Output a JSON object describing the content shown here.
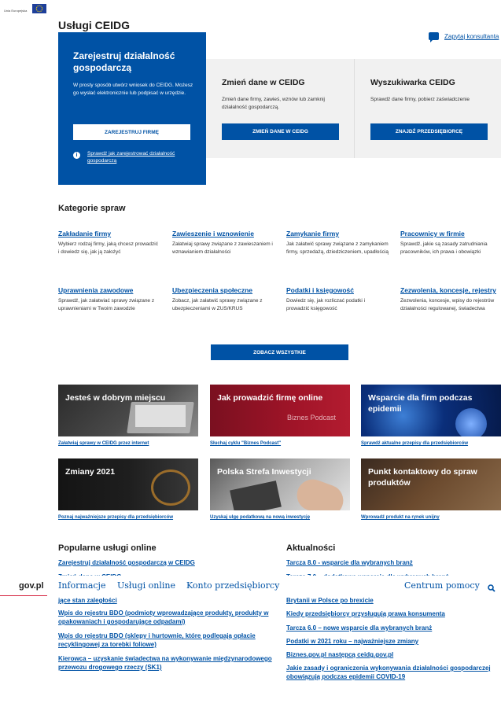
{
  "eu_label": "Unia Europejska",
  "page_title": "Usługi CEIDG",
  "consult_link": "Zapytaj konsultanta",
  "hero": {
    "title": "Zarejestruj działalność gospodarczą",
    "desc": "W prosty sposób utwórz wniosek do CEIDG. Możesz go wysłać elektronicznie lub podpisać w urzędzie.",
    "button": "ZAREJESTRUJ FIRMĘ",
    "info_link": "Sprawdź jak zarejestrować działalność gospodarczą"
  },
  "cards": [
    {
      "title": "Zmień dane w CEIDG",
      "desc": "Zmień dane firmy, zawieś, wznów lub zamknij działalność gospodarczą.",
      "button": "ZMIEŃ DANE W CEIDG"
    },
    {
      "title": "Wyszukiwarka CEIDG",
      "desc": "Sprawdź dane firmy, pobierz zaświadczenie",
      "button": "ZNAJDŹ PRZEDSIĘBIORCĘ"
    }
  ],
  "categories_title": "Kategorie spraw",
  "categories": [
    {
      "title": "Zakładanie firmy",
      "desc": "Wybierz rodzaj firmy, jaką chcesz prowadzić i dowiedz się, jak ją założyć"
    },
    {
      "title": "Zawieszenie i wznowienie",
      "desc": "Załatwiaj sprawy związane z zawieszaniem i wznawianiem działalności"
    },
    {
      "title": "Zamykanie firmy",
      "desc": "Jak załatwić sprawy związane z zamykaniem firmy, sprzedażą, dziedziczeniem, upadłością"
    },
    {
      "title": "Pracownicy w firmie",
      "desc": "Sprawdź, jakie są zasady zatrudniania pracowników, ich prawa i obowiązki"
    },
    {
      "title": "Uprawnienia zawodowe",
      "desc": "Sprawdź, jak załatwiać sprawy związane z uprawnieniami w Twoim zawodzie"
    },
    {
      "title": "Ubezpieczenia społeczne",
      "desc": "Zobacz, jak załatwić sprawy związane z ubezpieczeniami w ZUS/KRUS"
    },
    {
      "title": "Podatki i księgowość",
      "desc": "Dowiedz się, jak rozliczać podatki i prowadzić księgowość"
    },
    {
      "title": "Zezwolenia, koncesje, rejestry",
      "desc": "Zezwolenia, koncesje, wpisy do rejestrów działalności regulowanej, świadectwa"
    }
  ],
  "see_all": "ZOBACZ WSZYSTKIE",
  "tiles": [
    {
      "title": "Jesteś w dobrym miejscu",
      "caption": "Załatwiaj sprawy w CEIDG przez internet",
      "subtitle": ""
    },
    {
      "title": "Jak prowadzić firmę online",
      "caption": "Słuchaj cyklu \"Biznes Podcast\"",
      "subtitle": "Biznes Podcast"
    },
    {
      "title": "Wsparcie dla firm podczas epidemii",
      "caption": "Sprawdź aktualne przepisy dla przedsiębiorców",
      "subtitle": ""
    },
    {
      "title": "Zmiany 2021",
      "caption": "Poznaj najważniejsze przepisy dla przedsiębiorców",
      "subtitle": ""
    },
    {
      "title": "Polska Strefa Inwestycji",
      "caption": "Uzyskaj ulgę podatkową na nową inwestycję",
      "subtitle": ""
    },
    {
      "title": "Punkt kontaktowy do spraw produktów",
      "caption": "Wprowadź produkt na rynek unijny",
      "subtitle": ""
    }
  ],
  "popular_title": "Popularne usługi online",
  "popular": [
    "Zarejestruj działalność gospodarczą w CEIDG",
    "Zmień dane w CEIDG",
    "jące stan zaległości",
    "Wpis do rejestru BDO (podmioty wprowadzające produkty, produkty w opakowaniach i gospodarujące odpadami)",
    "Wpis do rejestru BDO (sklepy i hurtownie, które podlegają opłacie recyklingowej za torebki foliowe)",
    "Kierowca – uzyskanie świadectwa na wykonywanie międzynarodowego przewozu drogowego rzeczy (SK1)"
  ],
  "news_title": "Aktualności",
  "news": [
    "Tarcza 8.0 - wsparcie dla wybranych branż",
    "Tarcza 7.0 – dodatkowe wsparcie dla wybranych branż",
    "Brytanii w Polsce po brexicie",
    "Kiedy przedsiębiorcy przysługują prawa konsumenta",
    "Tarcza 6.0 – nowe wsparcie dla wybranych branż",
    "Podatki w 2021 roku – najważniejsze zmiany",
    "Biznes.gov.pl następcą ceidg.gov.pl",
    "Jakie zasady i ograniczenia wykonywania działalności gospodarczej obowiązują podczas epidemii COVID-19"
  ],
  "govbar": {
    "logo": "gov.pl",
    "nav": [
      "Informacje",
      "Usługi online",
      "Konto przedsiębiorcy"
    ],
    "help": "Centrum pomocy"
  },
  "colors": {
    "brand": "#0052a5",
    "accent_red": "#d4213d"
  }
}
